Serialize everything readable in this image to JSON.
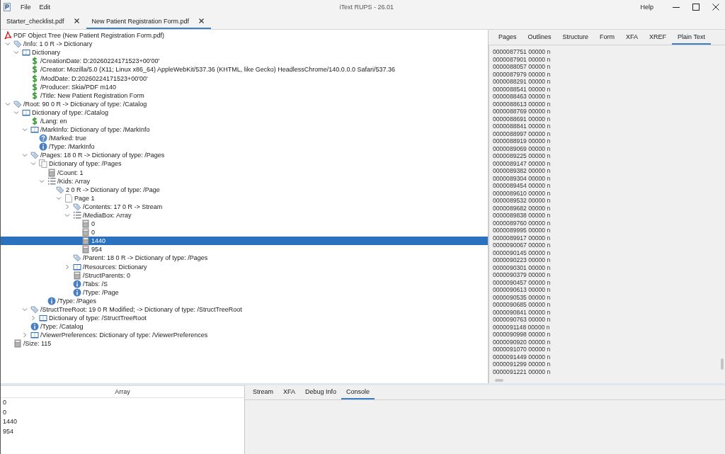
{
  "window": {
    "title": "iText RUPS - 26.01",
    "menu": [
      "File",
      "Edit"
    ],
    "help": "Help"
  },
  "file_tabs": [
    {
      "label": "Starter_checklist.pdf",
      "selected": false
    },
    {
      "label": "New Patient Registration Form.pdf",
      "selected": true
    }
  ],
  "tree": {
    "root": "PDF Object Tree (New Patient Registration Form.pdf)",
    "children": [
      {
        "label": "/Info: 1 0 R -> Dictionary",
        "kind": "ref",
        "expanded": true,
        "selected": false,
        "children": [
          {
            "label": "Dictionary",
            "kind": "dict",
            "expanded": true,
            "selected": false,
            "children": [
              {
                "label": "/CreationDate: D:20260224171523+00'00'",
                "kind": "string",
                "selected": false
              },
              {
                "label": "/Creator: Mozilla/5.0 (X11; Linux x86_64) AppleWebKit/537.36 (KHTML, like Gecko) HeadlessChrome/140.0.0.0 Safari/537.36",
                "kind": "string",
                "selected": false
              },
              {
                "label": "/ModDate: D:20260224171523+00'00'",
                "kind": "string",
                "selected": false
              },
              {
                "label": "/Producer: Skia/PDF m140",
                "kind": "string",
                "selected": false
              },
              {
                "label": "/Title: New Patient Registration Form",
                "kind": "string",
                "selected": false
              }
            ]
          }
        ]
      },
      {
        "label": "/Root: 90 0 R -> Dictionary of type: /Catalog",
        "kind": "ref",
        "expanded": true,
        "selected": false,
        "children": [
          {
            "label": "Dictionary of type: /Catalog",
            "kind": "dict",
            "expanded": true,
            "selected": false,
            "children": [
              {
                "label": "/Lang: en",
                "kind": "string",
                "selected": false
              },
              {
                "label": "/MarkInfo: Dictionary of type: /MarkInfo",
                "kind": "dict",
                "expanded": true,
                "selected": false,
                "children": [
                  {
                    "label": "/Marked: true",
                    "kind": "boolean",
                    "selected": false
                  },
                  {
                    "label": "/Type: /MarkInfo",
                    "kind": "name",
                    "selected": false
                  }
                ]
              },
              {
                "label": "/Pages: 18 0 R -> Dictionary of type: /Pages",
                "kind": "ref",
                "expanded": true,
                "selected": false,
                "children": [
                  {
                    "label": "Dictionary of type: /Pages",
                    "kind": "pages",
                    "expanded": true,
                    "selected": false,
                    "children": [
                      {
                        "label": "/Count: 1",
                        "kind": "number",
                        "selected": false
                      },
                      {
                        "label": "/Kids: Array",
                        "kind": "array",
                        "expanded": true,
                        "selected": false,
                        "children": [
                          {
                            "label": "2 0 R -> Dictionary of type: /Page",
                            "kind": "ref",
                            "selected": false,
                            "children": [
                              {
                                "label": "Page 1",
                                "kind": "page",
                                "expanded": true,
                                "selected": false,
                                "children": [
                                  {
                                    "label": "/Contents: 17 0 R -> Stream",
                                    "kind": "ref",
                                    "expanded": false,
                                    "selected": false
                                  },
                                  {
                                    "label": "/MediaBox: Array",
                                    "kind": "array",
                                    "expanded": true,
                                    "selected": false,
                                    "children": [
                                      {
                                        "label": "0",
                                        "kind": "number",
                                        "selected": false
                                      },
                                      {
                                        "label": "0",
                                        "kind": "number",
                                        "selected": false
                                      },
                                      {
                                        "label": "1440",
                                        "kind": "number",
                                        "selected": true
                                      },
                                      {
                                        "label": "954",
                                        "kind": "number",
                                        "selected": false
                                      }
                                    ]
                                  },
                                  {
                                    "label": "/Parent: 18 0 R -> Dictionary of type: /Pages",
                                    "kind": "ref",
                                    "selected": false
                                  },
                                  {
                                    "label": "/Resources: Dictionary",
                                    "kind": "dict",
                                    "expanded": false,
                                    "selected": false
                                  },
                                  {
                                    "label": "/StructParents: 0",
                                    "kind": "number",
                                    "selected": false
                                  },
                                  {
                                    "label": "/Tabs: /S",
                                    "kind": "name",
                                    "selected": false
                                  },
                                  {
                                    "label": "/Type: /Page",
                                    "kind": "name",
                                    "selected": false
                                  }
                                ]
                              }
                            ]
                          }
                        ]
                      },
                      {
                        "label": "/Type: /Pages",
                        "kind": "name",
                        "selected": false
                      }
                    ]
                  }
                ]
              },
              {
                "label": "/StructTreeRoot: 19 0 R Modified; -> Dictionary of type: /StructTreeRoot",
                "kind": "ref",
                "expanded": true,
                "selected": false,
                "children": [
                  {
                    "label": "Dictionary of type: /StructTreeRoot",
                    "kind": "dict",
                    "expanded": false,
                    "selected": false
                  }
                ]
              },
              {
                "label": "/Type: /Catalog",
                "kind": "name",
                "selected": false
              },
              {
                "label": "/ViewerPreferences: Dictionary of type: /ViewerPreferences",
                "kind": "dict",
                "expanded": false,
                "selected": false
              }
            ]
          }
        ]
      },
      {
        "label": "/Size: 115",
        "kind": "number",
        "selected": false
      }
    ]
  },
  "side_tabs": [
    {
      "label": "Pages",
      "selected": false
    },
    {
      "label": "Outlines",
      "selected": false
    },
    {
      "label": "Structure",
      "selected": false
    },
    {
      "label": "Form",
      "selected": false
    },
    {
      "label": "XFA",
      "selected": false
    },
    {
      "label": "XREF",
      "selected": false
    },
    {
      "label": "Plain Text",
      "selected": true
    }
  ],
  "plain_text": [
    "0000087751 00000 n",
    "0000087901 00000 n",
    "0000088057 00000 n",
    "0000087979 00000 n",
    "0000088291 00000 n",
    "0000088541 00000 n",
    "0000088463 00000 n",
    "0000088613 00000 n",
    "0000088769 00000 n",
    "0000088691 00000 n",
    "0000088841 00000 n",
    "0000088997 00000 n",
    "0000088919 00000 n",
    "0000089069 00000 n",
    "0000089225 00000 n",
    "0000089147 00000 n",
    "0000089382 00000 n",
    "0000089304 00000 n",
    "0000089454 00000 n",
    "0000089610 00000 n",
    "0000089532 00000 n",
    "0000089682 00000 n",
    "0000089838 00000 n",
    "0000089760 00000 n",
    "0000089995 00000 n",
    "0000089917 00000 n",
    "0000090067 00000 n",
    "0000090145 00000 n",
    "0000090223 00000 n",
    "0000090301 00000 n",
    "0000090379 00000 n",
    "0000090457 00000 n",
    "0000090613 00000 n",
    "0000090535 00000 n",
    "0000090685 00000 n",
    "0000090841 00000 n",
    "0000090763 00000 n",
    "0000091148 00000 n",
    "0000090998 00000 n",
    "0000090920 00000 n",
    "0000091070 00000 n",
    "0000091449 00000 n",
    "0000091299 00000 n",
    "0000091221 00000 n"
  ],
  "array_table": {
    "header": "Array",
    "rows": [
      "0",
      "0",
      "1440",
      "954"
    ]
  },
  "bottom_tabs": [
    {
      "label": "Stream",
      "selected": false
    },
    {
      "label": "XFA",
      "selected": false
    },
    {
      "label": "Debug Info",
      "selected": false
    },
    {
      "label": "Console",
      "selected": true
    }
  ]
}
